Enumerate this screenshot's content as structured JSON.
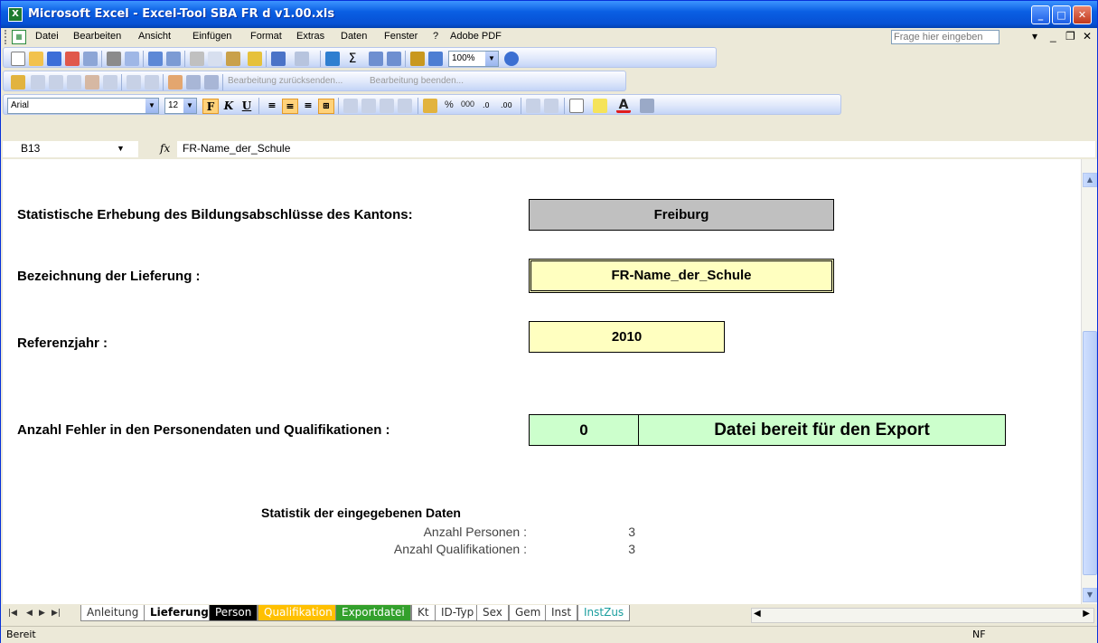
{
  "window": {
    "title": "Microsoft Excel - Excel-Tool SBA FR d v1.00.xls"
  },
  "menu": {
    "items": [
      "Datei",
      "Bearbeiten",
      "Ansicht",
      "Einfügen",
      "Format",
      "Extras",
      "Daten",
      "Fenster",
      "?",
      "Adobe PDF"
    ],
    "help_placeholder": "Frage hier eingeben"
  },
  "toolbar": {
    "zoom": "100%",
    "review_send": "Bearbeitung zurücksenden...",
    "review_end": "Bearbeitung beenden...",
    "font": "Arial",
    "font_size": "12",
    "bold": "F",
    "italic": "K",
    "underline": "U",
    "percent": "%",
    "thousands": "000"
  },
  "formula_bar": {
    "cell_ref": "B13",
    "fx": "fx",
    "content": "FR-Name_der_Schule"
  },
  "sheet": {
    "erhebung_label": "Statistische Erhebung des Bildungsabschlüsse des Kantons:",
    "kanton": "Freiburg",
    "lieferung_label": "Bezeichnung der Lieferung :",
    "lieferung_value": "FR-Name_der_Schule",
    "referenz_label": "Referenzjahr :",
    "referenz_value": "2010",
    "fehler_label": "Anzahl Fehler in den Personendaten und Qualifikationen :",
    "fehler_count": "0",
    "fehler_status": "Datei bereit für den Export",
    "stat_title": "Statistik der eingegebenen Daten",
    "personen_label": "Anzahl Personen :",
    "personen_value": "3",
    "qual_label": "Anzahl Qualifikationen :",
    "qual_value": "3"
  },
  "tabs": [
    {
      "label": "Anleitung",
      "bg": "#ffffff",
      "fg": "#333333"
    },
    {
      "label": "Lieferung",
      "bg": "#ffffff",
      "fg": "#000000"
    },
    {
      "label": "Person",
      "bg": "#000000",
      "fg": "#ffffff"
    },
    {
      "label": "Qualifikation",
      "bg": "#ffc000",
      "fg": "#ffffff"
    },
    {
      "label": "Exportdatei",
      "bg": "#33a02c",
      "fg": "#ffffff"
    },
    {
      "label": "Kt",
      "bg": "#ffffff",
      "fg": "#333333"
    },
    {
      "label": "ID-Typ",
      "bg": "#ffffff",
      "fg": "#333333"
    },
    {
      "label": "Sex",
      "bg": "#ffffff",
      "fg": "#333333"
    },
    {
      "label": "Gem",
      "bg": "#ffffff",
      "fg": "#333333"
    },
    {
      "label": "Inst",
      "bg": "#ffffff",
      "fg": "#333333"
    },
    {
      "label": "InstZus",
      "bg": "#ffffff",
      "fg": "#1a9e9e"
    }
  ],
  "status": {
    "left": "Bereit",
    "right": "NF"
  },
  "colors": {
    "gray_box": "#c0c0c0",
    "yellow_box": "#ffffc0",
    "green_box": "#ccffcc"
  }
}
